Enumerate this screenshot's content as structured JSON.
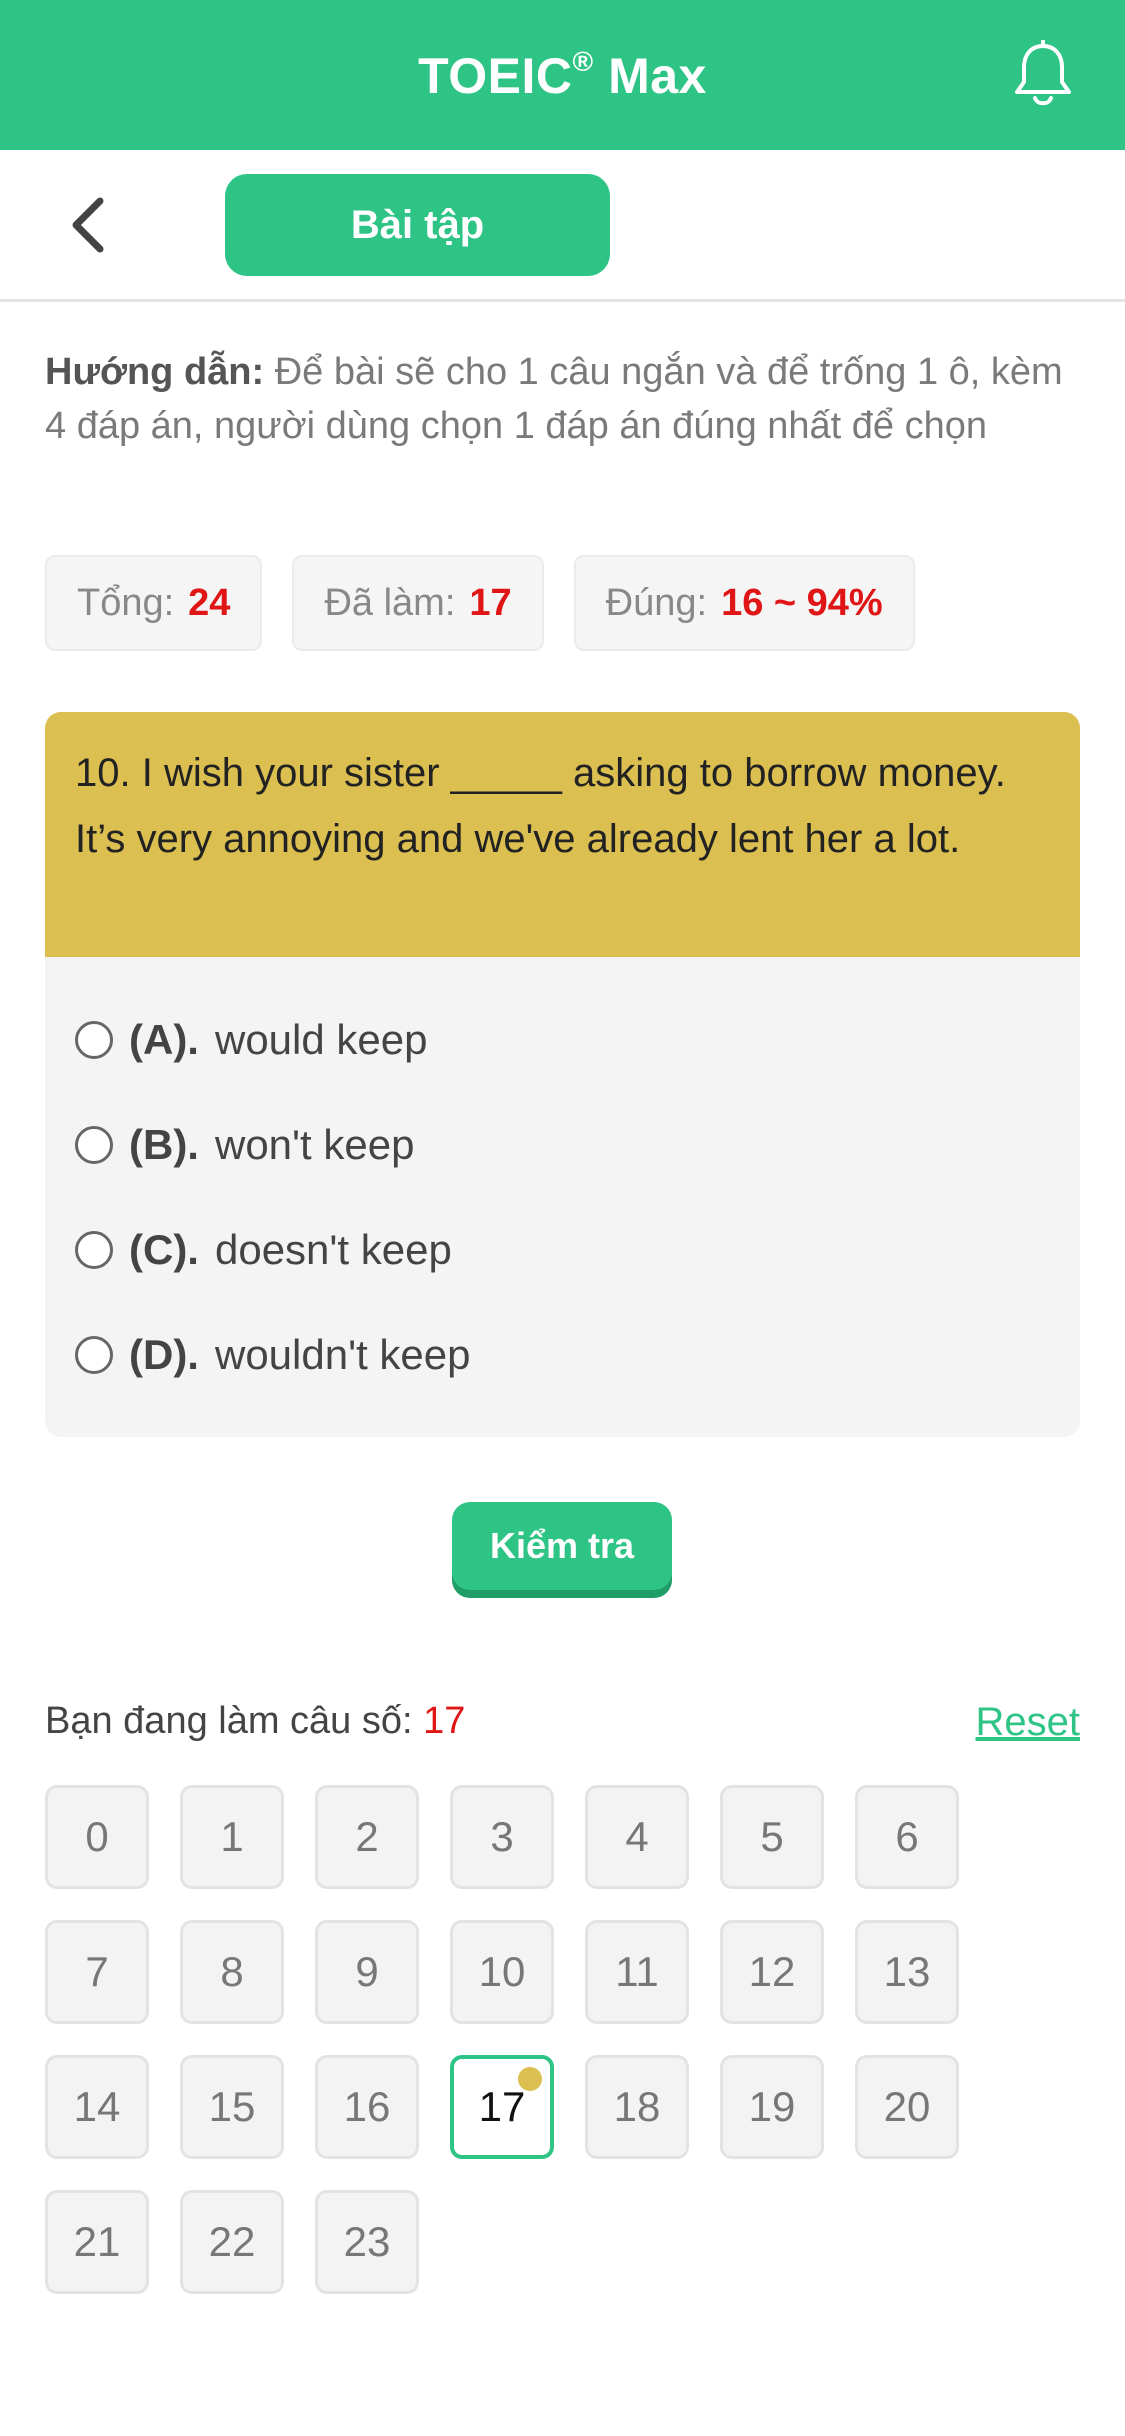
{
  "header": {
    "title": "TOEIC",
    "title_mark": "®",
    "title_suffix": " Max",
    "icon": "bell-icon"
  },
  "toolbar": {
    "back_icon": "chevron-left-icon",
    "tab_label": "Bài tập"
  },
  "instructions": {
    "label": "Hướng dẫn:",
    "text": " Để bài sẽ cho 1 câu ngắn và để trống 1 ô, kèm 4 đáp án, người dùng chọn 1 đáp án đúng nhất để chọn"
  },
  "stats": {
    "total_label": "Tổng:",
    "total_value": "24",
    "done_label": "Đã làm:",
    "done_value": "17",
    "correct_label": "Đúng:",
    "correct_value": "16 ~ 94%"
  },
  "question": {
    "text": "10. I wish your sister _____ asking to borrow money. It’s very annoying and we've already lent her a lot.",
    "options": [
      {
        "letter": "(A).",
        "text": "would keep"
      },
      {
        "letter": "(B).",
        "text": "won't keep"
      },
      {
        "letter": "(C).",
        "text": "doesn't keep"
      },
      {
        "letter": "(D).",
        "text": "wouldn't keep"
      }
    ]
  },
  "check_label": "Kiểm tra",
  "progress": {
    "label": "Bạn đang làm câu số: ",
    "current": "17",
    "reset_label": "Reset"
  },
  "numbers": [
    "0",
    "1",
    "2",
    "3",
    "4",
    "5",
    "6",
    "7",
    "8",
    "9",
    "10",
    "11",
    "12",
    "13",
    "14",
    "15",
    "16",
    "17",
    "18",
    "19",
    "20",
    "21",
    "22",
    "23"
  ],
  "current_number": "17",
  "colors": {
    "accent": "#2ec486",
    "question_bg": "#dbbf50",
    "highlight_value": "#e01515"
  }
}
